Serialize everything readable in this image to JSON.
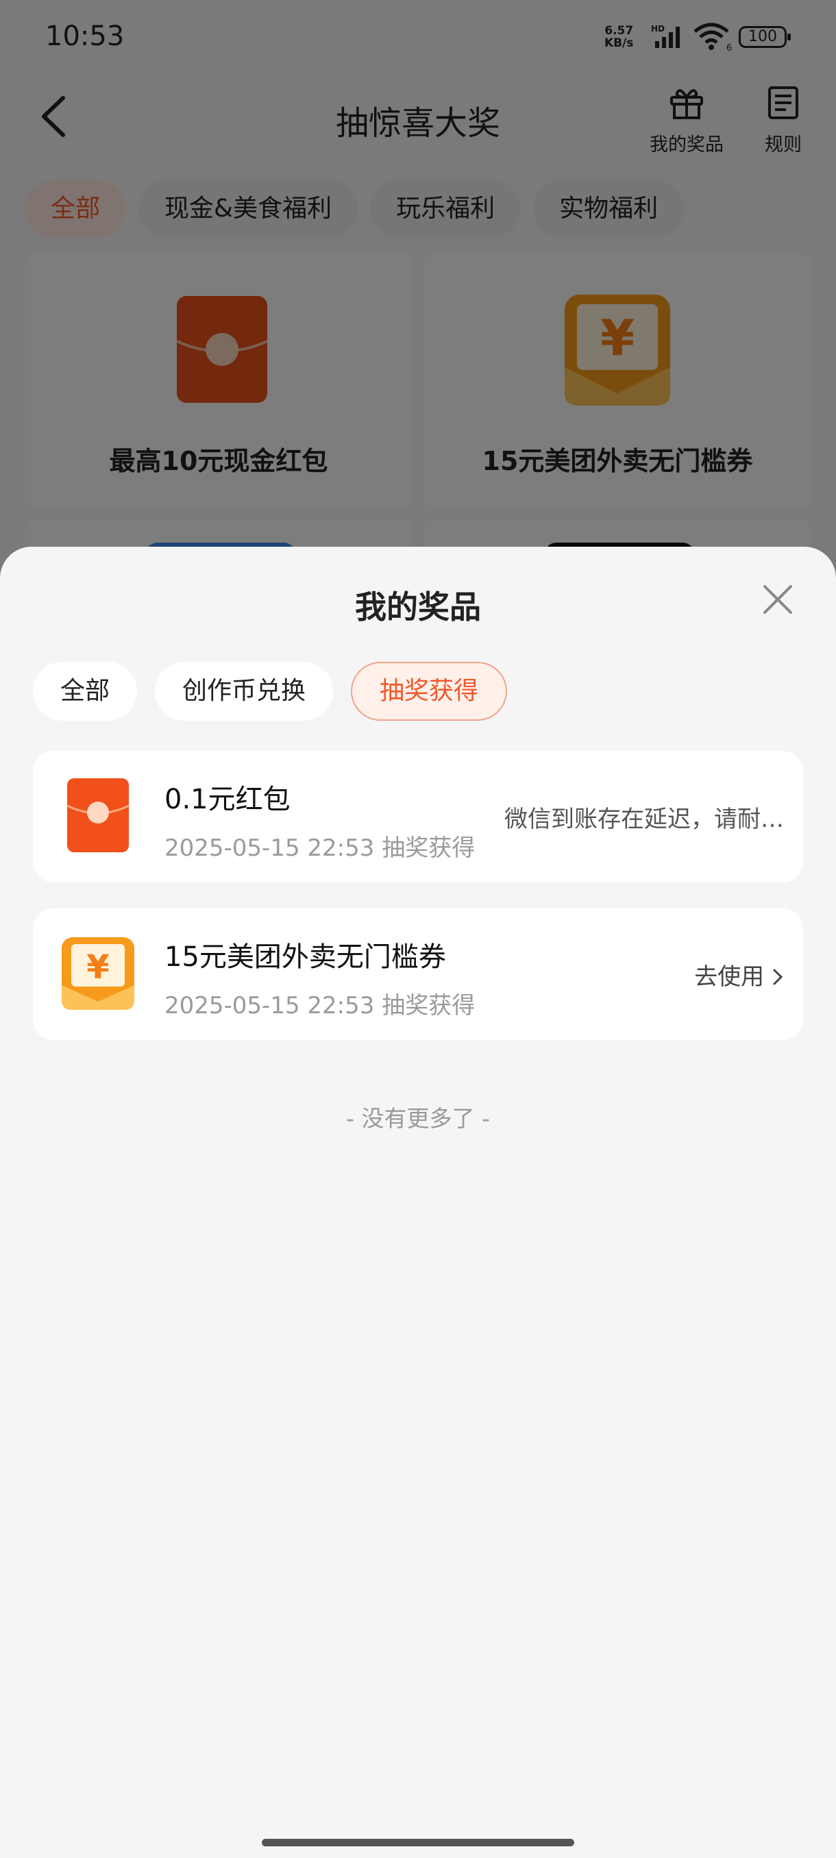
{
  "status_bar": {
    "time": "10:53",
    "net_speed_value": "6.57",
    "net_speed_unit": "KB/s",
    "hd_label": "HD",
    "signal_label": "6",
    "battery": "100"
  },
  "header": {
    "title": "抽惊喜大奖",
    "my_prizes_label": "我的奖品",
    "rules_label": "规则"
  },
  "categories": [
    "全部",
    "现金&美食福利",
    "玩乐福利",
    "实物福利"
  ],
  "prize_cards": [
    {
      "name": "最高10元现金红包"
    },
    {
      "name": "15元美团外卖无门槛券"
    }
  ],
  "sheet": {
    "title": "我的奖品",
    "filters": [
      "全部",
      "创作币兑换",
      "抽奖获得"
    ],
    "active_filter": "抽奖获得",
    "items": [
      {
        "name": "0.1元红包",
        "date": "2025-05-15 22:53 抽奖获得",
        "status": "微信到账存在延迟，请耐…"
      },
      {
        "name": "15元美团外卖无门槛券",
        "date": "2025-05-15 22:53 抽奖获得",
        "action": "去使用"
      }
    ],
    "no_more": "- 没有更多了 -"
  },
  "colors": {
    "accent": "#f2582b",
    "red_packet": "#e8501c",
    "coupon": "#f7a21b"
  }
}
